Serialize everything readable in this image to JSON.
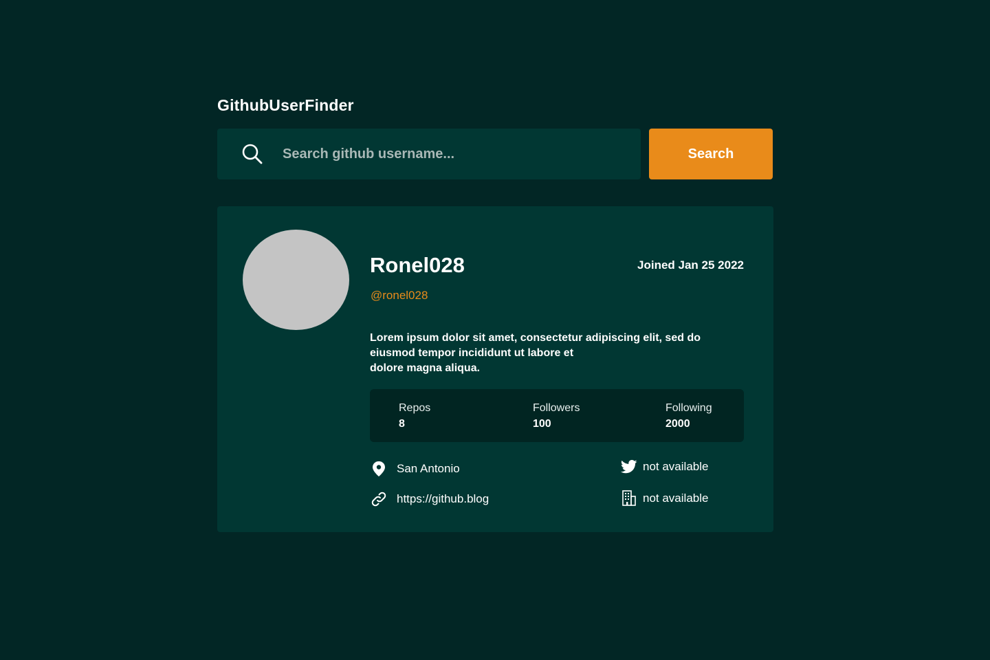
{
  "app": {
    "title": "GithubUserFinder"
  },
  "search": {
    "placeholder": "Search github username...",
    "button_label": "Search",
    "icon": "search-icon"
  },
  "profile": {
    "name": "Ronel028",
    "joined": "Joined Jan 25 2022",
    "username": "@ronel028",
    "bio_lines": [
      "Lorem ipsum dolor sit amet, consectetur adipiscing elit, sed do",
      "eiusmod tempor incididunt ut labore et",
      "dolore magna aliqua."
    ],
    "stats": {
      "repos": {
        "label": "Repos",
        "value": "8"
      },
      "followers": {
        "label": "Followers",
        "value": "100"
      },
      "following": {
        "label": "Following",
        "value": "2000"
      }
    },
    "info": {
      "location": {
        "icon": "location-pin-icon",
        "text": "San Antonio"
      },
      "blog": {
        "icon": "link-icon",
        "text": "https://github.blog"
      },
      "twitter": {
        "icon": "twitter-icon",
        "text": "not available"
      },
      "company": {
        "icon": "building-icon",
        "text": "not available"
      }
    }
  },
  "colors": {
    "background": "#022625",
    "surface": "#013733",
    "stats_background": "#012522",
    "accent": "#e98b1a",
    "avatar_placeholder": "#c4c4c4"
  }
}
